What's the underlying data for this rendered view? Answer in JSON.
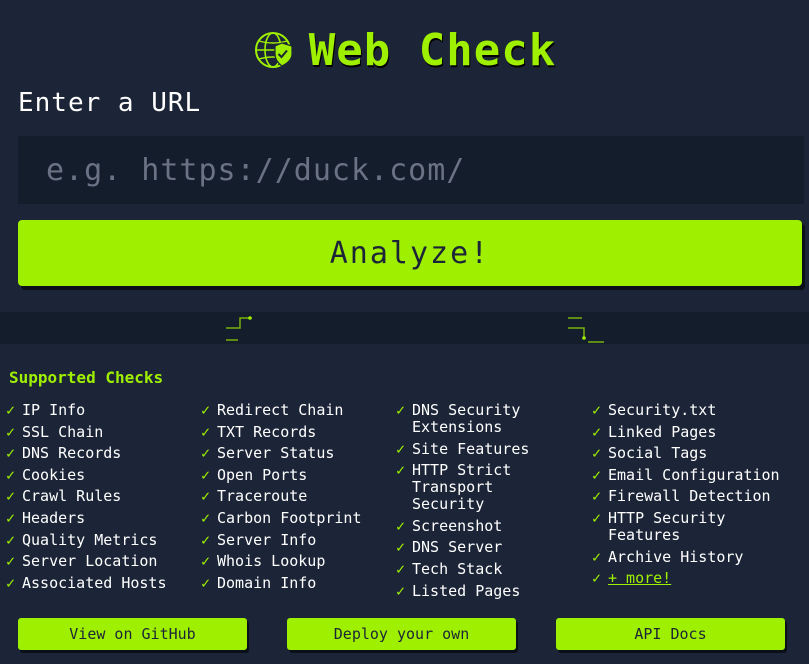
{
  "header": {
    "title": "Web Check"
  },
  "url_form": {
    "label": "Enter a URL",
    "placeholder": "e.g. https://duck.com/",
    "value": "",
    "submit_label": "Analyze!"
  },
  "supported_checks": {
    "title": "Supported Checks",
    "tick": "✓",
    "columns": [
      [
        "IP Info",
        "SSL Chain",
        "DNS Records",
        "Cookies",
        "Crawl Rules",
        "Headers",
        "Quality Metrics",
        "Server Location",
        "Associated Hosts"
      ],
      [
        "Redirect Chain",
        "TXT Records",
        "Server Status",
        "Open Ports",
        "Traceroute",
        "Carbon Footprint",
        "Server Info",
        "Whois Lookup",
        "Domain Info"
      ],
      [
        "DNS Security\nExtensions",
        "Site Features",
        "HTTP Strict Transport\nSecurity",
        "Screenshot",
        "DNS Server",
        "Tech Stack",
        "Listed Pages"
      ],
      [
        "Security.txt",
        "Linked Pages",
        "Social Tags",
        "Email Configuration",
        "Firewall Detection",
        "HTTP Security\nFeatures",
        "Archive History"
      ]
    ],
    "more_label": "+ more!"
  },
  "links": {
    "github": "View on GitHub",
    "deploy": "Deploy your own",
    "api_docs": "API Docs"
  },
  "colors": {
    "accent": "#9fef00",
    "background": "#141d2b",
    "panel": "#1c2537",
    "input_bg": "#141d2b",
    "text": "#ffffff"
  }
}
